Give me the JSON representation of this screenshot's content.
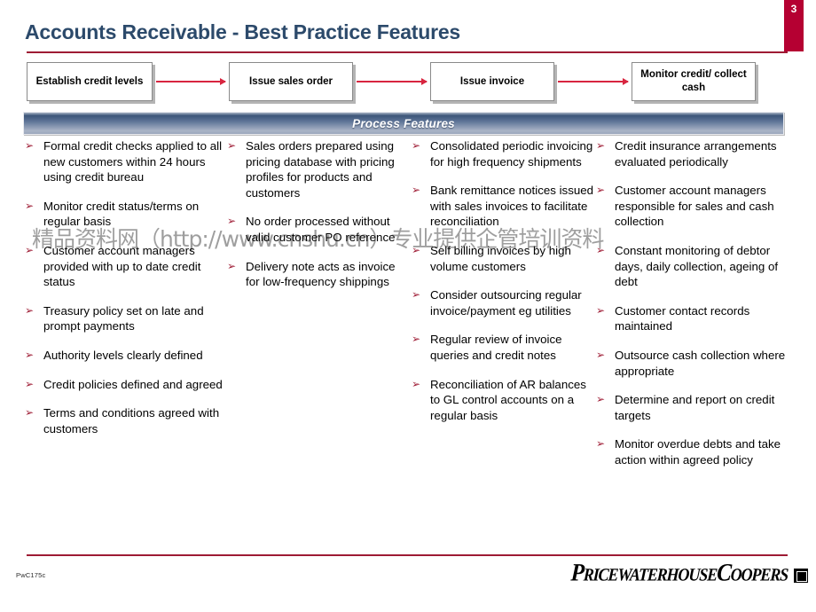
{
  "slide": {
    "page_number": "3",
    "title": "Accounts Receivable - Best Practice Features",
    "footer_code": "PwC175c",
    "watermark": "精品资料网（http://www.cnshu.cn）专业提供企管培训资料",
    "accent_crimson": "#9e1b34",
    "accent_badge": "#b50032",
    "title_color": "#2c4a6b",
    "arrow_color": "#d8253f"
  },
  "flow": {
    "boxes": [
      {
        "label": "Establish credit levels"
      },
      {
        "label": "Issue sales order"
      },
      {
        "label": "Issue invoice"
      },
      {
        "label": "Monitor credit/ collect cash"
      }
    ]
  },
  "banner": {
    "label": "Process Features"
  },
  "logo": {
    "wordmark": "PricewaterhouseCoopers",
    "mark": "pwc-square-mark"
  },
  "columns": [
    {
      "items": [
        "Formal credit checks applied to all new customers within 24 hours using credit bureau",
        "Monitor credit status/terms on regular basis",
        "Customer account managers provided with up to date credit status",
        "Treasury policy set on late and prompt payments",
        "Authority levels clearly defined",
        "Credit policies defined and agreed",
        "Terms and conditions agreed with customers"
      ]
    },
    {
      "items": [
        "Sales orders prepared using pricing database with pricing profiles for products and customers",
        "No order processed without valid customer PO reference",
        "Delivery note acts as invoice for low-frequency shippings"
      ]
    },
    {
      "items": [
        "Consolidated periodic invoicing for high frequency shipments",
        "Bank remittance notices issued with sales invoices to facilitate reconciliation",
        "Self billing invoices by high volume customers",
        "Consider outsourcing regular invoice/payment eg utilities",
        "Regular review of invoice queries and credit notes",
        "Reconciliation of AR balances to GL control accounts on a regular basis"
      ]
    },
    {
      "items": [
        "Credit insurance arrangements evaluated periodically",
        "Customer account managers responsible for sales and cash collection",
        "Constant monitoring of debtor days, daily collection, ageing of debt",
        "Customer contact records maintained",
        "Outsource cash collection where appropriate",
        "Determine and report on credit targets",
        "Monitor overdue debts and take action within agreed policy"
      ]
    }
  ]
}
